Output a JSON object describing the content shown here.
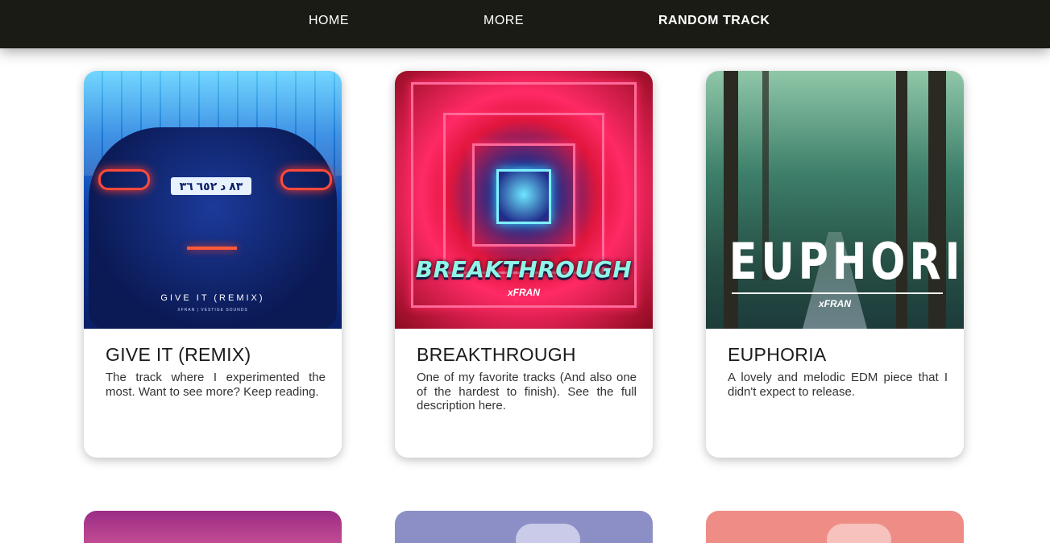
{
  "nav": {
    "home": "HOME",
    "more": "MORE",
    "random": "RANDOM TRACK"
  },
  "cards": [
    {
      "title": "GIVE IT (REMIX)",
      "description": "The track where I experimented the most. Want to see more? Keep reading.",
      "art_caption": "GIVE IT (REMIX)",
      "art_subcaption": "XFRAN | VESTIGE SOUNDS",
      "art_plate": "٨٣ د ٦٥٢ ٣٦"
    },
    {
      "title": "BREAKTHROUGH",
      "description": "One of my favorite tracks (And also one of the hardest to finish). See the full description here.",
      "art_caption": "BREAKTHROUGH",
      "art_tag": "xFRAN"
    },
    {
      "title": "EUPHORIA",
      "description": "A lovely and melodic EDM piece that I didn't expect to release.",
      "art_caption": "EUPHORIA",
      "art_tag": "xFRAN"
    }
  ],
  "colors": {
    "navbar": "#1b1b15",
    "peek_1": "#b03a8a",
    "peek_2": "#8c8fc6",
    "peek_3": "#ee8d86"
  }
}
